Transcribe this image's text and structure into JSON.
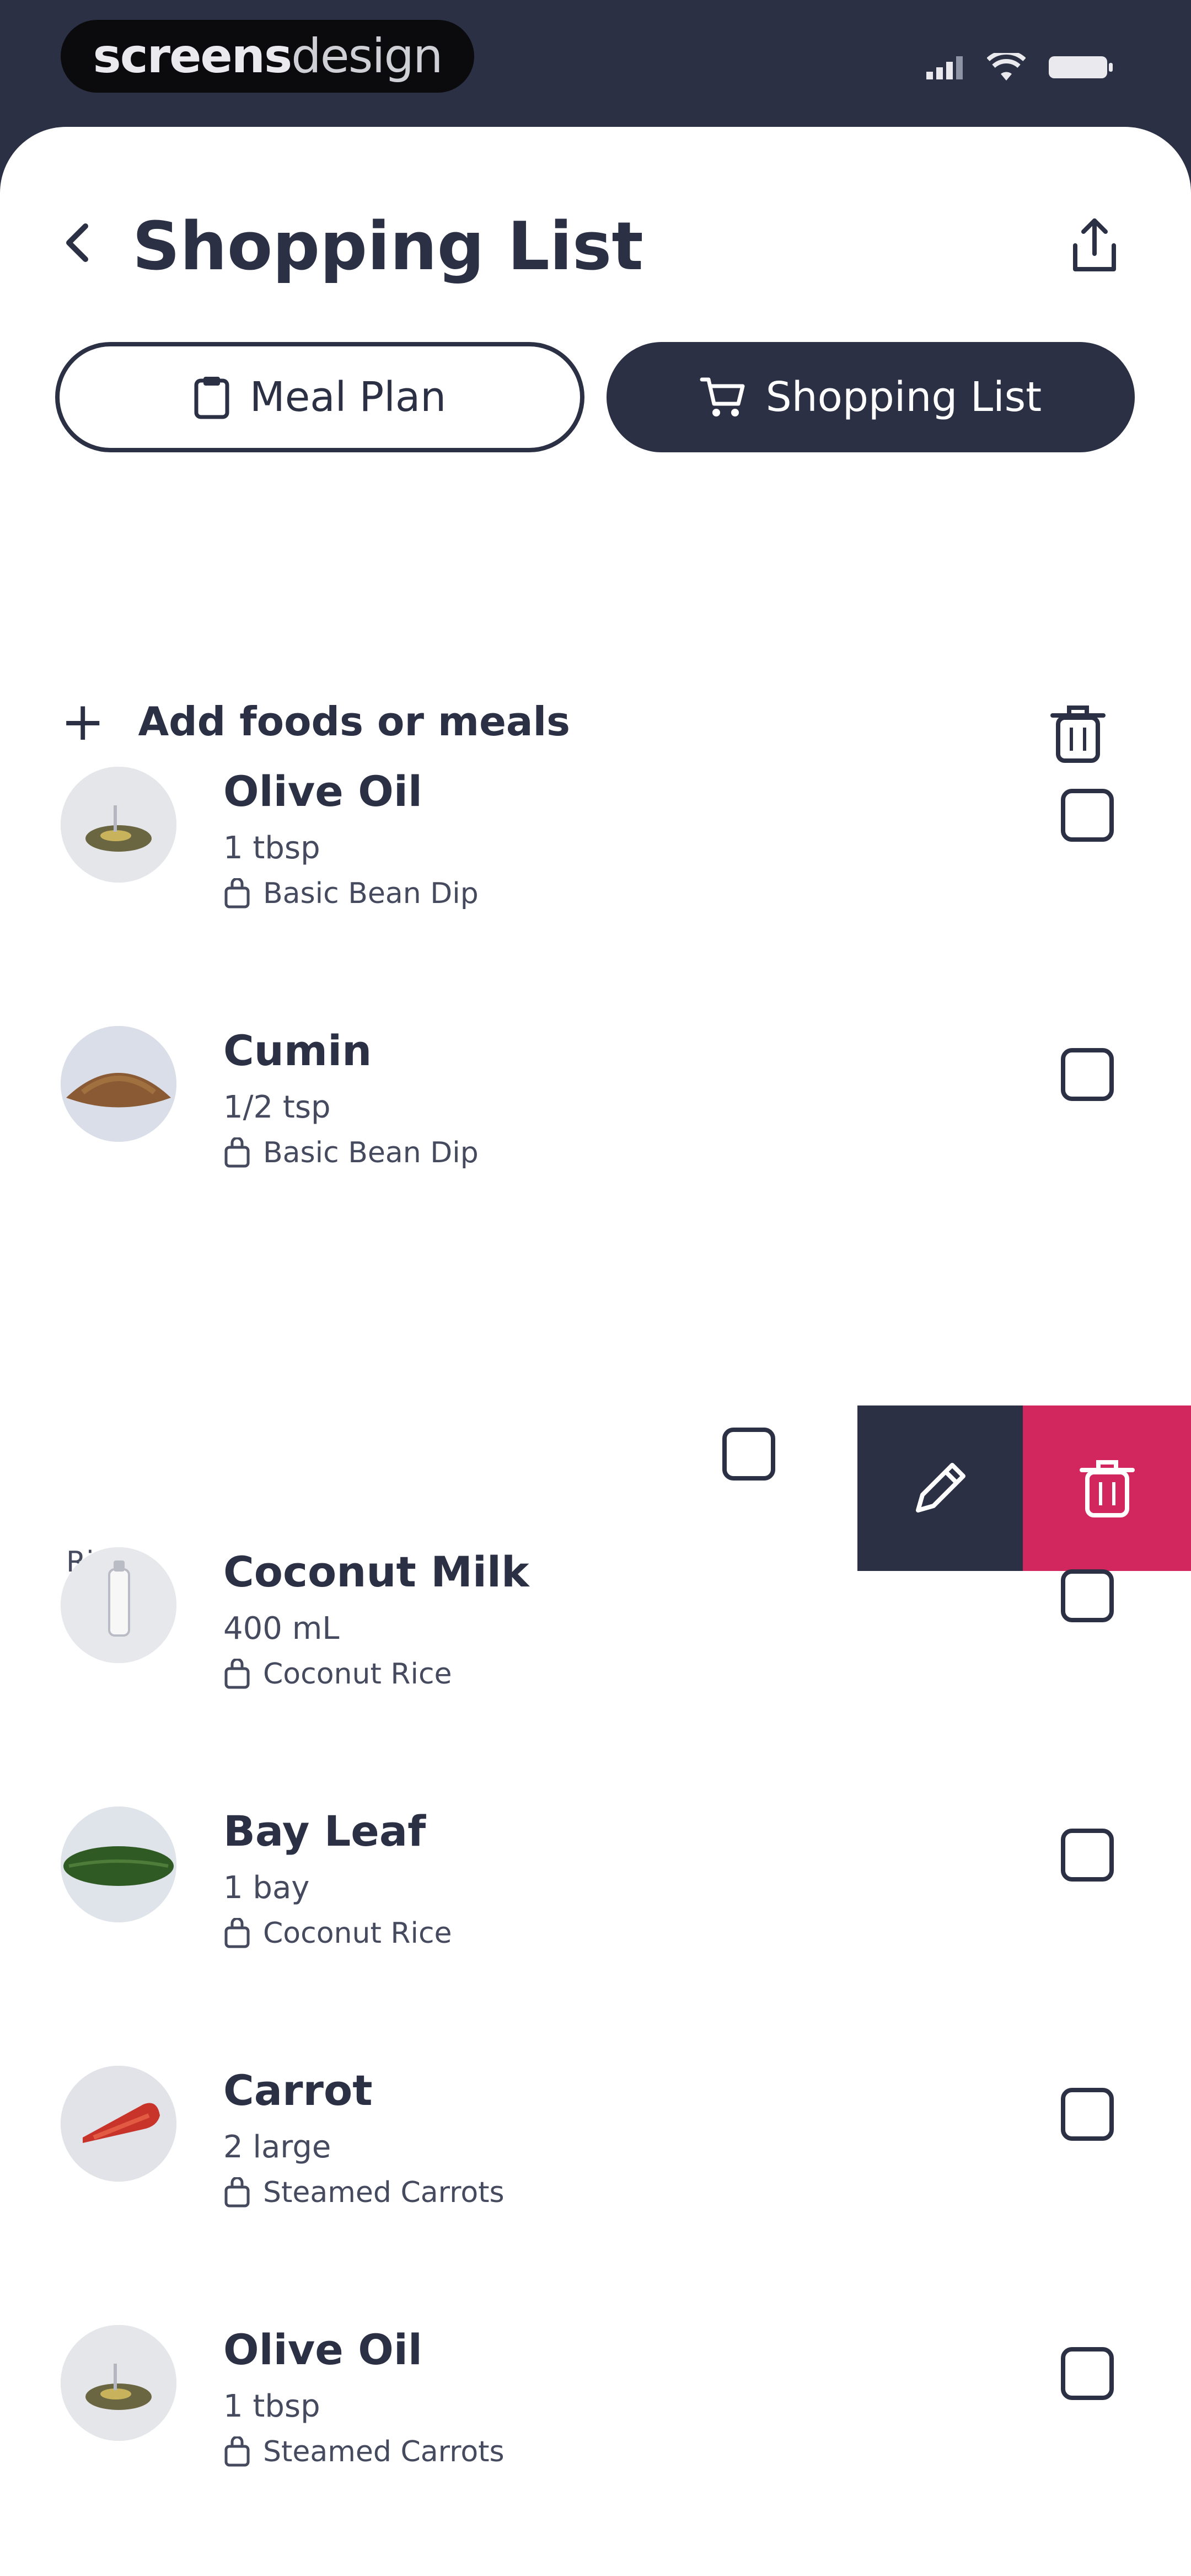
{
  "status_bar": {
    "brand_bold": "screens",
    "brand_light": "design"
  },
  "header": {
    "title": "Shopping List"
  },
  "tabs": [
    {
      "label": "Meal Plan",
      "icon": "clipboard-icon",
      "active": false
    },
    {
      "label": "Shopping List",
      "icon": "cart-icon",
      "active": true
    }
  ],
  "add_row": {
    "label": "Add foods or meals"
  },
  "items": [
    {
      "name": "Olive Oil",
      "qty": "1 tbsp",
      "meal": "Basic Bean Dip",
      "image": "olive-oil-image"
    },
    {
      "name": "Cumin",
      "qty": "1/2 tsp",
      "meal": "Basic Bean Dip",
      "image": "cumin-image"
    },
    {
      "name": "Coconut Milk",
      "qty": "400 mL",
      "meal": "Coconut Rice",
      "image": "coconut-milk-image"
    },
    {
      "name": "Bay Leaf",
      "qty": "1 bay",
      "meal": "Coconut Rice",
      "image": "bay-leaf-image"
    },
    {
      "name": "Carrot",
      "qty": "2 large",
      "meal": "Steamed Carrots",
      "image": "carrot-image"
    },
    {
      "name": "Olive Oil",
      "qty": "1 tbsp",
      "meal": "Steamed Carrots",
      "image": "olive-oil-image"
    }
  ],
  "swiped_item": {
    "visible_fragment": "Rice"
  },
  "colors": {
    "primary": "#2b3044",
    "danger": "#d2265f",
    "background": "#ffffff"
  }
}
